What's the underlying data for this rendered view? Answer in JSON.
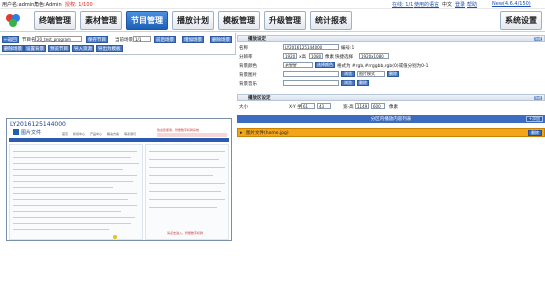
{
  "topbar": {
    "username_label": "用户名:admin",
    "role_label": "角色:Admin",
    "auth_label": "授权: 1/100",
    "online_label": "在线: 1/1",
    "help_link": "使用的语言",
    "lang_label": "中文",
    "login_label": "登录",
    "help_label": "帮助",
    "version_label": "New(4.6.4/150)"
  },
  "nav": {
    "items": [
      {
        "label": "终端管理"
      },
      {
        "label": "素材管理"
      },
      {
        "label": "节目管理"
      },
      {
        "label": "播放计划"
      },
      {
        "label": "模板管理"
      },
      {
        "label": "升级管理"
      },
      {
        "label": "统计报表"
      }
    ],
    "settings_label": "系统设置"
  },
  "toolbar": {
    "back_label": "←返回",
    "program_name_label": "节目名:",
    "program_name_value": "20_test_program",
    "save_label": "保存节目",
    "current_scene_label": "当前场景",
    "scene_value": "1/1",
    "prev_scene": "前后场景",
    "add_scene": "增加场景",
    "del_scene": "删除场景",
    "row2": [
      "删除场景",
      "设置背景",
      "预览节目",
      "导入资源",
      "导出为模板"
    ]
  },
  "preview": {
    "doc_title": "LY2016125144000",
    "doc_subtitle": "图片文件",
    "doc_header_right": "欢迎您使用，智能数字标牌系统",
    "doc_tabs": [
      "首页",
      "新闻中心",
      "产品中心",
      "解决方案",
      "联系我们"
    ],
    "doc_footer_right": "请点击进入，智能数字标牌"
  },
  "scene_settings": {
    "header": "播放设定",
    "mini_btn": "隐藏",
    "name_label": "名称",
    "name_value": "LY2016125144000",
    "scene_no_label": "编号:1",
    "resolution_label": "分辨率",
    "width_value": "1920",
    "x_label": "x高",
    "height_value": "1080",
    "unit_label": "像素",
    "quick_select_label": "快捷选择",
    "quick_select_value": "1920x1080",
    "bgcolor_label": "背景颜色",
    "bgcolor_value": "#ffffff",
    "pick_color_btn": "选择颜色",
    "bgcolor_hint": "格式为 #rgb,#rrggbb,rgb(0)或值分别为0-1",
    "bgimage_label": "背景图片",
    "browse_btn": "浏览",
    "image_mode_label": "图片模式",
    "delete_btn": "删除",
    "bgmusic_label": "背景音乐",
    "browse_btn2": "浏览",
    "delete_btn2": "删除"
  },
  "region_settings": {
    "header": "播放区设定",
    "mini_btn": "隐藏",
    "size_label": "大小",
    "xy_label": "X-Y 坐",
    "x_value": "61",
    "y_value": "43",
    "wh_label": "宽-高",
    "w_value": "1149",
    "h_value": "600",
    "unit_label": "像素"
  },
  "file_list": {
    "header": "分区内播放内容列表",
    "add_btn": "+添加",
    "file_label": "图片文件(home.jpg)",
    "delete_btn": "删除"
  },
  "colors": {
    "nav_active": "#1d5fb7",
    "toolbar_btn": "#4a78c2",
    "file_row": "#f2a41b",
    "section_bar": "#3b6cc0"
  }
}
